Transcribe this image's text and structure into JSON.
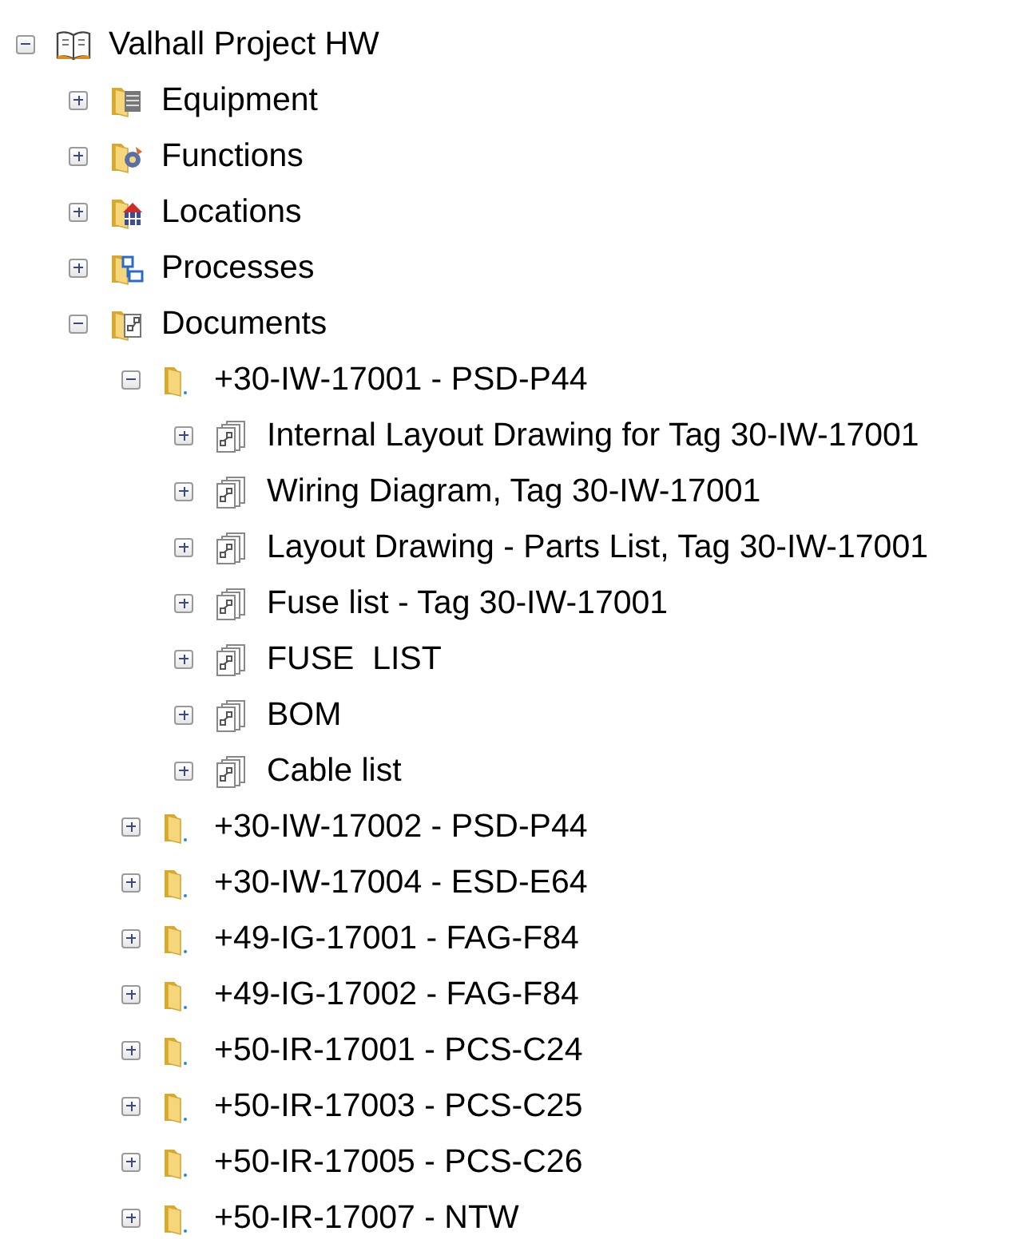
{
  "tree": {
    "label": "Valhall Project HW",
    "kind": "project",
    "expanded": true,
    "children": [
      {
        "label": "Equipment",
        "kind": "equipment",
        "expanded": false
      },
      {
        "label": "Functions",
        "kind": "functions",
        "expanded": false
      },
      {
        "label": "Locations",
        "kind": "locations",
        "expanded": false
      },
      {
        "label": "Processes",
        "kind": "processes",
        "expanded": false
      },
      {
        "label": "Documents",
        "kind": "documents",
        "expanded": true,
        "children": [
          {
            "label": "+30-IW-17001 - PSD-P44",
            "kind": "folder",
            "expanded": true,
            "children": [
              {
                "label": "Internal Layout Drawing for Tag 30-IW-17001",
                "kind": "document",
                "expanded": false
              },
              {
                "label": "Wiring Diagram, Tag 30-IW-17001",
                "kind": "document",
                "expanded": false
              },
              {
                "label": "Layout Drawing - Parts List, Tag 30-IW-17001",
                "kind": "document",
                "expanded": false
              },
              {
                "label": "Fuse list - Tag 30-IW-17001",
                "kind": "document",
                "expanded": false
              },
              {
                "label": "FUSE  LIST",
                "kind": "document",
                "expanded": false
              },
              {
                "label": "BOM",
                "kind": "document",
                "expanded": false
              },
              {
                "label": "Cable list",
                "kind": "document",
                "expanded": false
              }
            ]
          },
          {
            "label": "+30-IW-17002 - PSD-P44",
            "kind": "folder",
            "expanded": false
          },
          {
            "label": "+30-IW-17004 - ESD-E64",
            "kind": "folder",
            "expanded": false
          },
          {
            "label": "+49-IG-17001 - FAG-F84",
            "kind": "folder",
            "expanded": false
          },
          {
            "label": "+49-IG-17002 - FAG-F84",
            "kind": "folder",
            "expanded": false
          },
          {
            "label": "+50-IR-17001 - PCS-C24",
            "kind": "folder",
            "expanded": false
          },
          {
            "label": "+50-IR-17003 - PCS-C25",
            "kind": "folder",
            "expanded": false
          },
          {
            "label": "+50-IR-17005 - PCS-C26",
            "kind": "folder",
            "expanded": false
          },
          {
            "label": "+50-IR-17007 - NTW",
            "kind": "folder",
            "expanded": false
          }
        ]
      }
    ]
  }
}
